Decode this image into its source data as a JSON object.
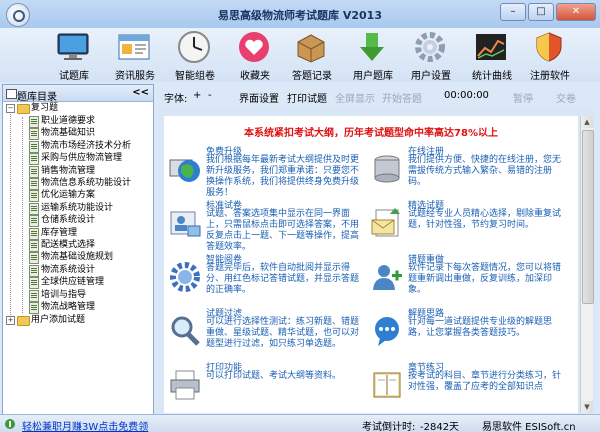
{
  "window": {
    "title": "易思高级物流师考试题库 V2013"
  },
  "toolbar": [
    {
      "label": "试题库",
      "icon": "monitor-icon"
    },
    {
      "label": "资讯服务",
      "icon": "browser-window-icon"
    },
    {
      "label": "智能组卷",
      "icon": "clock-icon"
    },
    {
      "label": "收藏夹",
      "icon": "heart-icon"
    },
    {
      "label": "答题记录",
      "icon": "package-box-icon"
    },
    {
      "label": "用户题库",
      "icon": "download-arrow-icon"
    },
    {
      "label": "用户设置",
      "icon": "gear-icon"
    },
    {
      "label": "统计曲线",
      "icon": "line-chart-icon"
    },
    {
      "label": "注册软件",
      "icon": "shield-icon"
    }
  ],
  "sidebar": {
    "title": "题库目录",
    "collapse": "<<",
    "root": "复习题",
    "items": [
      "职业道德要求",
      "物流基础知识",
      "物流市场经济技术分析",
      "采购与供应物流管理",
      "销售物流管理",
      "物流信息系统功能设计",
      "优化运输方案",
      "运输系统功能设计",
      "仓储系统设计",
      "库存管理",
      "配送模式选择",
      "物流基础设施规划",
      "物流系统设计",
      "全球供应链管理",
      "培训与指导",
      "物流战略管理"
    ],
    "user_node": "用户添加试题"
  },
  "topbar": {
    "font": "字体:",
    "plus": "+",
    "minus": "-",
    "settings": "界面设置",
    "print": "打印试题",
    "fullscreen": "全屏显示",
    "start": "开始答题",
    "timer": "00:00:00",
    "pause": "暂停",
    "submit": "交卷"
  },
  "content": {
    "banner": "本系统紧扣考试大纲，历年考试题型命中率高达78%以上",
    "features": [
      {
        "name": "免费升级",
        "desc": "我们根据每年最新考试大纲提供及时更新升级服务，我们郑重承诺：只要您不换操作系统，我们将提供终身免费升级服务！",
        "icon": "globe-icon"
      },
      {
        "name": "在线注册",
        "desc": "我们提供方便、快捷的在线注册，您无需拔传统方式输入繁杂、易错的注册码。",
        "icon": "database-icon"
      },
      {
        "name": "标准试卷",
        "desc": "试题、答案选项集中显示在同一界面上，只需鼠标点击即可选择答案，不用反复点击上一题、下一题等操作，提高答题效率。",
        "icon": "user-card-icon"
      },
      {
        "name": "精选试题",
        "desc": "试题经专业人员精心选择，剔除重复试题，针对性强，节约复习时间。",
        "icon": "email-icon"
      },
      {
        "name": "智能阅卷",
        "desc": "答题完毕后，软件自动批阅并显示得分、用红色标记答错试题，并显示答题的正确率。",
        "icon": "settings-cog-icon"
      },
      {
        "name": "错题重做",
        "desc": "软件记录下每次答题情况，您可以将错题重新调出重做，反复训练，加深印象。",
        "icon": "add-user-icon"
      },
      {
        "name": "试题过滤",
        "desc": "可以进行选择性测试：练习新题、错题重做、星级试题、精华试题，也可以对题型进行过滤，如只练习单选题。",
        "icon": "magnifier-icon"
      },
      {
        "name": "解题思路",
        "desc": "针对每一道试题提供专业级的解题思路，让您掌握各类答题技巧。",
        "icon": "chat-bubble-icon"
      },
      {
        "name": "打印功能",
        "desc": "可以打印试题、考试大纲等资料。",
        "icon": "printer-icon"
      },
      {
        "name": "章节练习",
        "desc": "按考试的科目、章节进行分类练习，针对性强，覆盖了应考的全部知识点",
        "icon": "book-icon"
      }
    ]
  },
  "statusbar": {
    "promo": "轻松兼职月赚3W点击免费领",
    "countdown_label": "考试倒计时:",
    "countdown_value": "-2842天",
    "company": "易思软件 ESISoft.cn"
  }
}
